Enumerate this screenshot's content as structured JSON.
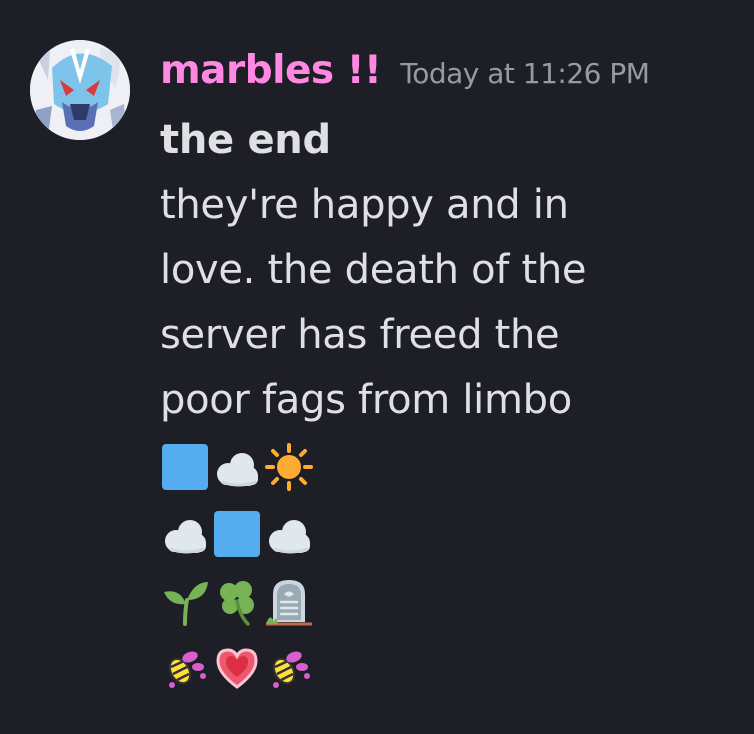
{
  "colors": {
    "background": "#1e1f26",
    "username": "#ff88e3",
    "timestamp": "#949ba4",
    "text": "#dfe0e4"
  },
  "message": {
    "author": "marbles !!",
    "timestamp": "Today at 11:26 PM",
    "lines": [
      "the end",
      "they're happy and in",
      "love. the death of the",
      "server has freed the",
      "poor fags from limbo"
    ],
    "emoji_rows": [
      [
        "blue-square-icon",
        "cloud-icon",
        "sun-icon"
      ],
      [
        "cloud-icon",
        "blue-square-icon",
        "cloud-icon"
      ],
      [
        "seedling-icon",
        "shamrock-icon",
        "headstone-icon"
      ],
      [
        "fly-icon",
        "heart-icon",
        "fly-icon"
      ]
    ]
  }
}
